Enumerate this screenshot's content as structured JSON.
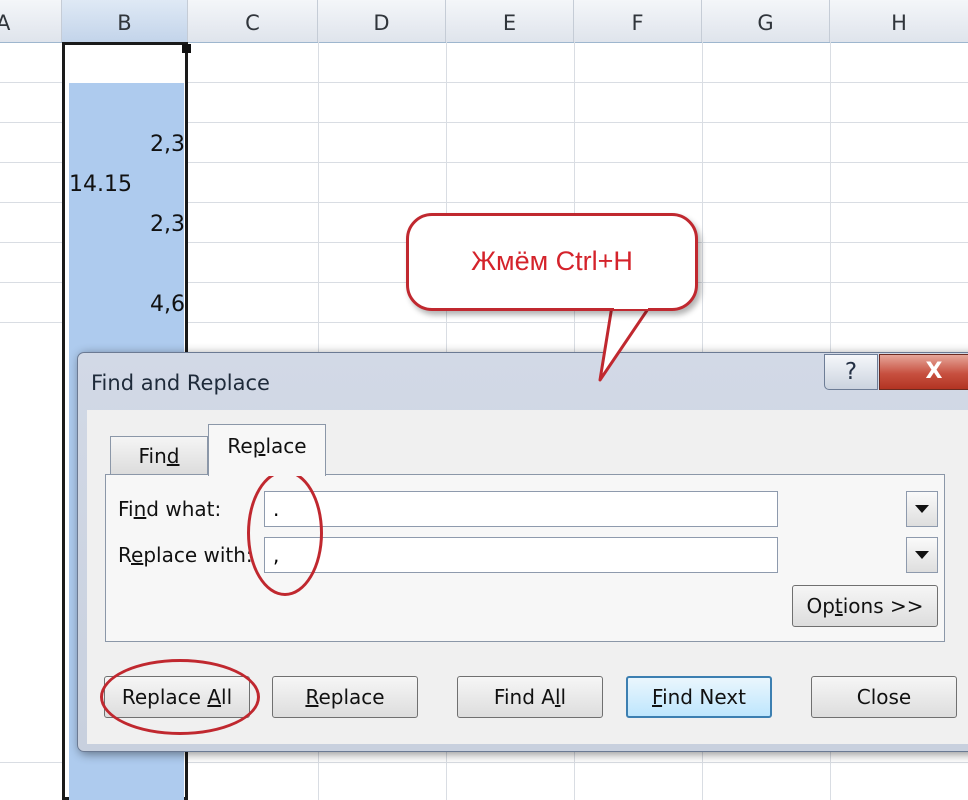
{
  "spreadsheet": {
    "columns": [
      "A",
      "B",
      "C",
      "D",
      "E",
      "F",
      "G",
      "H"
    ],
    "active_column": "B",
    "cells_b": [
      {
        "value": "2,3",
        "align": "right"
      },
      {
        "value": "14.15",
        "align": "left"
      },
      {
        "value": "2,3",
        "align": "right"
      },
      {
        "value": "4,6",
        "align": "right"
      }
    ],
    "selection_color": "#aecbee"
  },
  "callout": {
    "text": "Жмём Ctrl+H",
    "color": "#d4232b"
  },
  "dialog": {
    "title": "Find and Replace",
    "help_button": "?",
    "close_button": "X",
    "tabs": [
      {
        "label_pre": "Fin",
        "label_ul": "d",
        "label_post": "",
        "active": false
      },
      {
        "label_pre": "Re",
        "label_ul": "p",
        "label_post": "lace",
        "active": true
      }
    ],
    "find_what": {
      "label_pre": "Fi",
      "label_ul": "n",
      "label_post": "d what:",
      "value": "."
    },
    "replace_with": {
      "label_pre": "R",
      "label_ul": "e",
      "label_post": "place with:",
      "value": ","
    },
    "buttons": {
      "options": {
        "pre": "Op",
        "ul": "t",
        "post": "ions >>"
      },
      "replace_all": {
        "pre": "Replace ",
        "ul": "A",
        "post": "ll"
      },
      "replace": {
        "pre": "",
        "ul": "R",
        "post": "eplace"
      },
      "find_all": {
        "pre": "Find A",
        "ul": "",
        "post": "ll",
        "ul_first": "I"
      },
      "find_next": {
        "pre": "",
        "ul": "F",
        "post": "ind Next"
      },
      "close": {
        "pre": "Close",
        "ul": "",
        "post": ""
      }
    },
    "annotation_color": "#c0282f"
  }
}
